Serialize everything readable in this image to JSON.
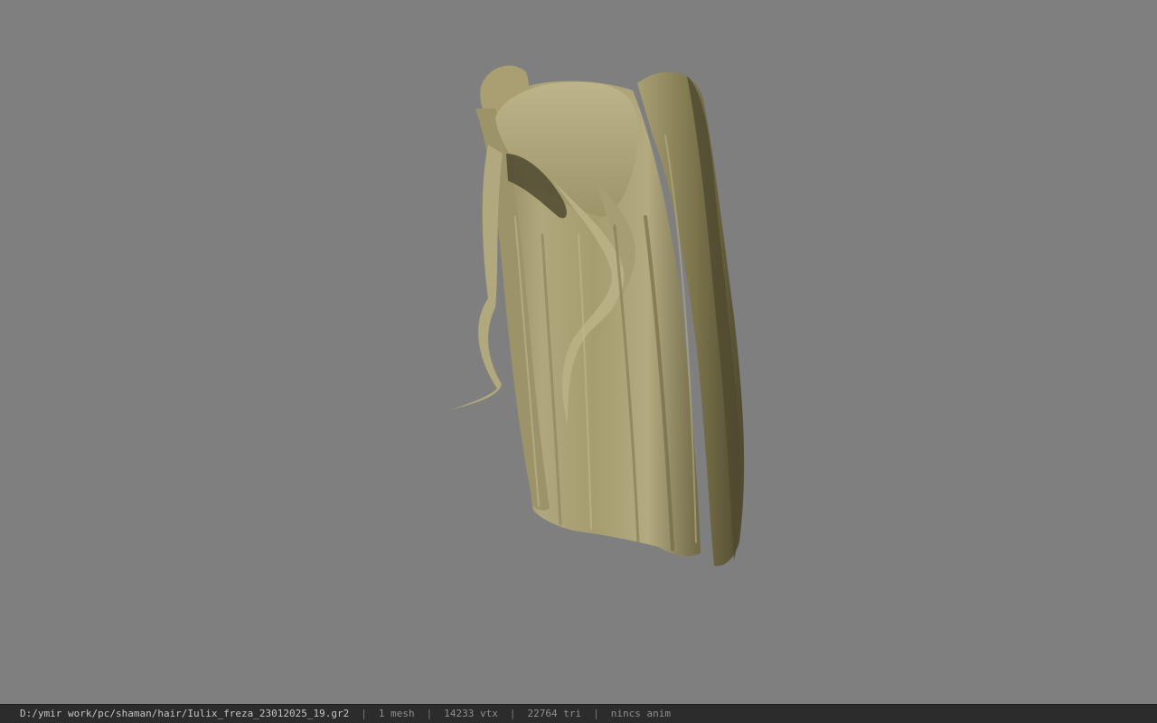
{
  "viewer": {
    "background_color": "#7f7f7f",
    "model_color": "#a89f73",
    "model_shadow_color": "#4f4a30"
  },
  "statusbar": {
    "file_path": "D:/ymir work/pc/shaman/hair/Iulix_freza_23012025_19.gr2",
    "mesh_count": "1 mesh",
    "vertex_count": "14233 vtx",
    "triangle_count": "22764 tri",
    "anim_status": "nincs anim",
    "separator": "|"
  }
}
